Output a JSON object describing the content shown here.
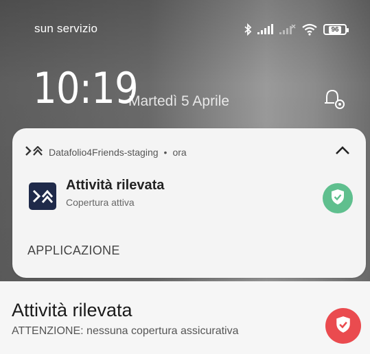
{
  "status_bar": {
    "carrier": "sun servizio",
    "battery": "96",
    "icons": [
      "bluetooth-icon",
      "signal-icon",
      "signal-none-icon",
      "wifi-icon",
      "battery-icon"
    ]
  },
  "lockscreen": {
    "time": "10:19",
    "date": "Martedì 5 Aprile"
  },
  "notification": {
    "app_name": "Datafolio4Friends-staging",
    "separator": "•",
    "time": "ora",
    "title": "Attività rilevata",
    "subtitle": "Copertura attiva",
    "action": "APPLICAZIONE",
    "badge_color": "#5fbf8e",
    "app_icon_color": "#1f2a4a"
  },
  "second_notification": {
    "title": "Attività rilevata",
    "subtitle": "ATTENZIONE: nessuna copertura assicurativa",
    "badge_color": "#ea4b4f"
  }
}
